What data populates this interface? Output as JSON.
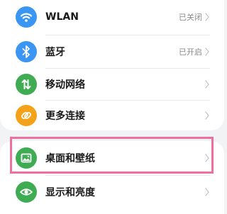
{
  "settings": {
    "items": [
      {
        "label": "WLAN",
        "value": "已关闭",
        "icon": "wifi-icon",
        "color": "#3a96f2"
      },
      {
        "label": "蓝牙",
        "value": "已开启",
        "icon": "bluetooth-icon",
        "color": "#3a96f2"
      },
      {
        "label": "移动网络",
        "value": "",
        "icon": "mobile-data-icon",
        "color": "#3fac54"
      },
      {
        "label": "更多连接",
        "value": "",
        "icon": "link-icon",
        "color": "#f4a21a"
      },
      {
        "label": "桌面和壁纸",
        "value": "",
        "icon": "wallpaper-icon",
        "color": "#3fac54"
      },
      {
        "label": "显示和亮度",
        "value": "",
        "icon": "eye-icon",
        "color": "#3fac54"
      }
    ]
  },
  "highlight": {
    "color": "#ef6f9f",
    "target": "桌面和壁纸"
  },
  "colors": {
    "background": "#f1f3f5",
    "card": "#ffffff",
    "chevron": "#c4c4c4"
  }
}
